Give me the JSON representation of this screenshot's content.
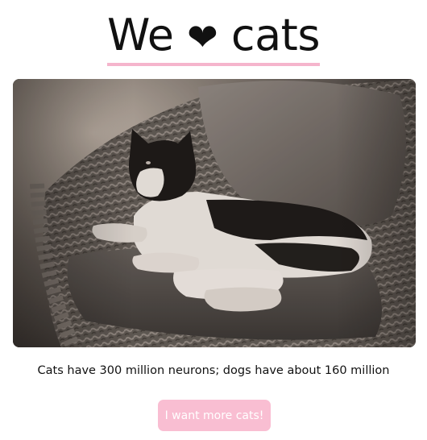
{
  "header": {
    "title_pre": "We",
    "heart_glyph": "❤",
    "title_post": "cats",
    "accent_color": "#f5b5cc"
  },
  "photo": {
    "subject": "black-and-white cat lying on a cushioned wicker chair",
    "tone": "sepia"
  },
  "fact": {
    "text": "Cats have 300 million neurons; dogs have about 160 million"
  },
  "actions": {
    "more_cats_label": "I want more cats!",
    "button_color": "#f9bed2"
  }
}
